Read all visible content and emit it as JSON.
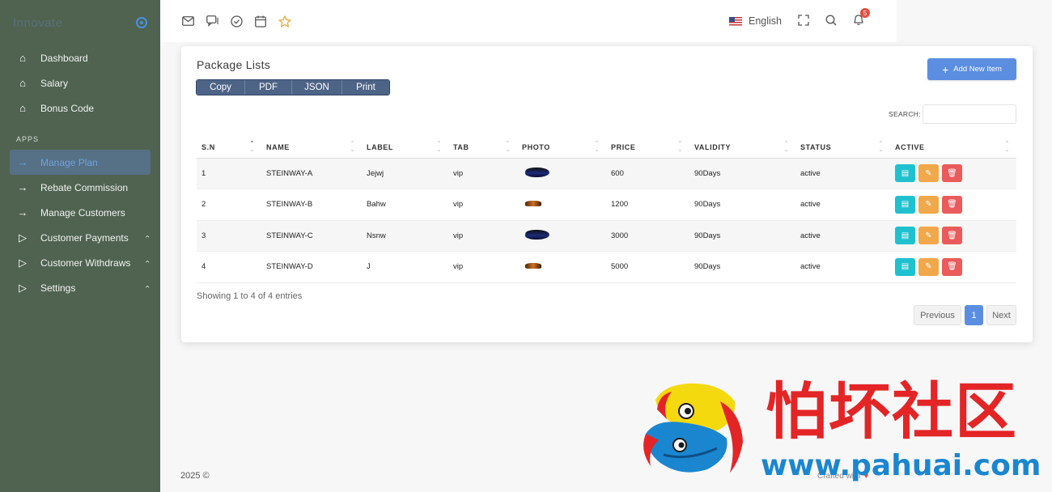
{
  "sidebar": {
    "brand": "Innovate",
    "items_top": [
      {
        "label": "Dashboard",
        "icon": "home-icon"
      },
      {
        "label": "Salary",
        "icon": "home-icon"
      },
      {
        "label": "Bonus Code",
        "icon": "home-icon"
      }
    ],
    "section": "APPS",
    "items_apps": [
      {
        "label": "Manage Plan",
        "icon": "arrow-right-icon"
      },
      {
        "label": "Rebate Commission",
        "icon": "arrow-right-icon"
      },
      {
        "label": "Manage Customers",
        "icon": "arrow-right-icon"
      },
      {
        "label": "Customer Payments",
        "icon": "play-icon"
      },
      {
        "label": "Customer Withdraws",
        "icon": "play-icon"
      },
      {
        "label": "Settings",
        "icon": "play-icon"
      }
    ]
  },
  "topbar": {
    "language": "English",
    "notifications": "5"
  },
  "card": {
    "title": "Package Lists",
    "export_buttons": [
      "Copy",
      "PDF",
      "JSON",
      "Print"
    ],
    "add_button": "Add New Item",
    "search_label": "SEARCH:",
    "search_value": ""
  },
  "table": {
    "headers": [
      "S.N",
      "NAME",
      "LABEL",
      "TAB",
      "PHOTO",
      "PRICE",
      "VALIDITY",
      "STATUS",
      "ACTIVE"
    ],
    "rows": [
      {
        "sn": "1",
        "name": "STEINWAY-A",
        "label": "Jejwj",
        "tab": "vip",
        "photo": "boat",
        "price": "600",
        "validity": "90Days",
        "status": "active"
      },
      {
        "sn": "2",
        "name": "STEINWAY-B",
        "label": "Bahw",
        "tab": "vip",
        "photo": "car",
        "price": "1200",
        "validity": "90Days",
        "status": "active"
      },
      {
        "sn": "3",
        "name": "STEINWAY-C",
        "label": "Nsnw",
        "tab": "vip",
        "photo": "boat",
        "price": "3000",
        "validity": "90Days",
        "status": "active"
      },
      {
        "sn": "4",
        "name": "STEINWAY-D",
        "label": "J",
        "tab": "vip",
        "photo": "car",
        "price": "5000",
        "validity": "90Days",
        "status": "active"
      }
    ],
    "showing": "Showing 1 to 4 of 4 entries"
  },
  "pagination": {
    "prev": "Previous",
    "page": "1",
    "next": "Next"
  },
  "footer": {
    "left": "2025 ©",
    "right": "Crafted with"
  },
  "watermark": {
    "cn": "怕坏社区",
    "url": "www.pahuai.com"
  },
  "colors": {
    "sidebar": "#4f6350",
    "primary": "#5b8ee0",
    "info": "#20c1cf",
    "warning": "#f0a84a",
    "danger": "#ea5b5b"
  }
}
